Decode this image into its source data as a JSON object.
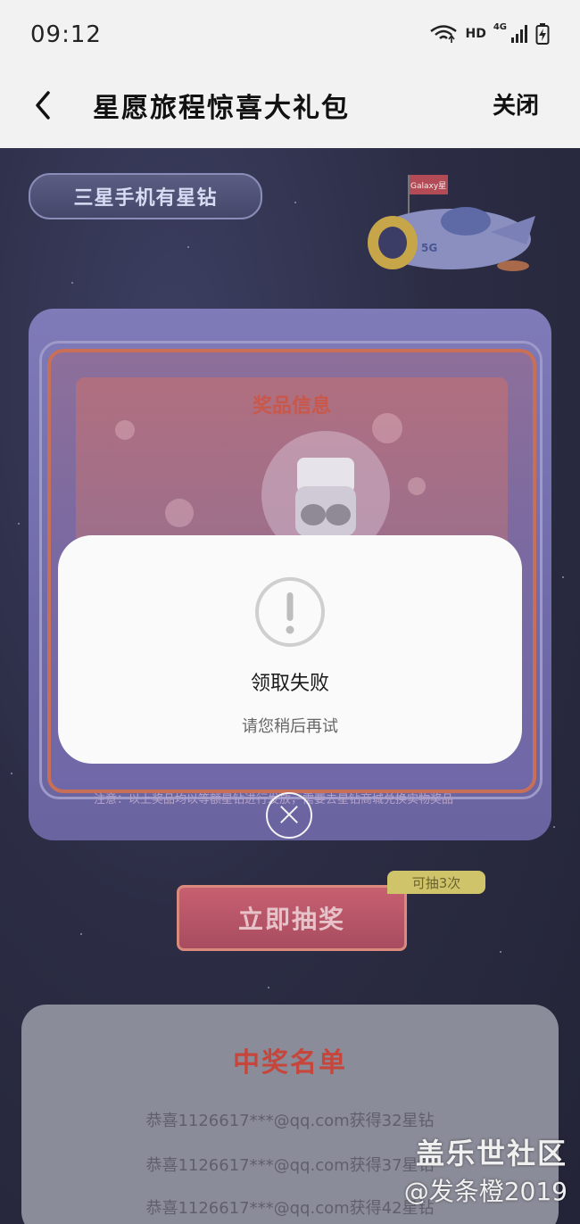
{
  "status_bar": {
    "time": "09:12",
    "hd_label": "HD",
    "network_label": "4G"
  },
  "header": {
    "title": "星愿旅程惊喜大礼包",
    "close_label": "关闭"
  },
  "page": {
    "brand_pill": "三星手机有星钻",
    "rocket_flag": "Galaxy星",
    "rocket_label": "5G",
    "prize_header": "奖品信息",
    "prize_note": "注意：以上奖品均以等额星钻进行发放，需要去星钻商城兑换实物奖品",
    "draw_button": "立即抽奖",
    "draws_left": "可抽3次",
    "winners_title": "中奖名单",
    "winners": [
      "恭喜1126617***@qq.com获得32星钻",
      "恭喜1126617***@qq.com获得37星钻",
      "恭喜1126617***@qq.com获得42星钻"
    ]
  },
  "dialog": {
    "title": "领取失败",
    "message": "请您稍后再试"
  },
  "watermark": {
    "line1": "盖乐世社区",
    "line2": "@发条橙2019"
  }
}
